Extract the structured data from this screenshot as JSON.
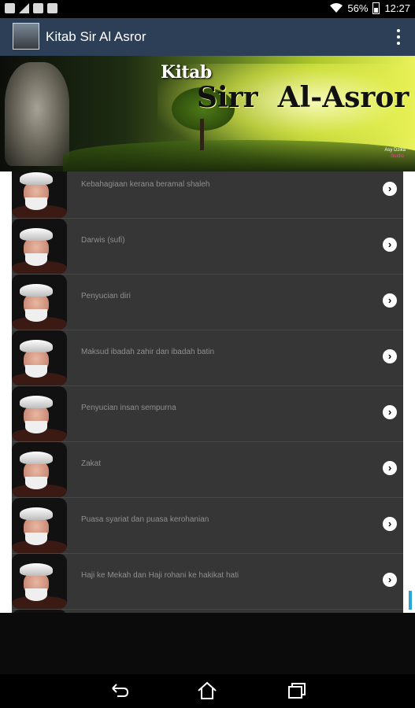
{
  "status_bar": {
    "battery_percent": "56%",
    "time": "12:27",
    "icons": [
      "mail-icon",
      "signal-icon",
      "z-icon",
      "gallery-icon",
      "wifi-icon",
      "battery-icon"
    ]
  },
  "app_bar": {
    "title": "Kitab Sir Al Asror",
    "menu_icon": "overflow-menu-icon"
  },
  "banner": {
    "line1": "Kitab",
    "line2": "Sirr  Al-Asror",
    "credit_line1": "Asy Dzika",
    "credit_line2": "Studio"
  },
  "list": {
    "items": [
      {
        "label": "Kebahagiaan kerana beramal shaleh"
      },
      {
        "label": "Darwis (sufi)"
      },
      {
        "label": "Penyucian diri"
      },
      {
        "label": "Maksud ibadah zahir dan ibadah batin"
      },
      {
        "label": "Penyucian insan sempurna"
      },
      {
        "label": "Zakat"
      },
      {
        "label": "Puasa syariat dan puasa kerohanian"
      },
      {
        "label": "Haji ke Mekah dan Haji rohani ke hakikat hati"
      },
      {
        "label": ""
      }
    ],
    "arrow_icon": "chevron-right-icon"
  },
  "nav_bar": {
    "buttons": [
      "back-icon",
      "home-icon",
      "recent-apps-icon"
    ]
  },
  "colors": {
    "app_bar": "#2c3f57",
    "list_item_bg": "#363636",
    "scroll_accent": "#2ba7d6"
  }
}
